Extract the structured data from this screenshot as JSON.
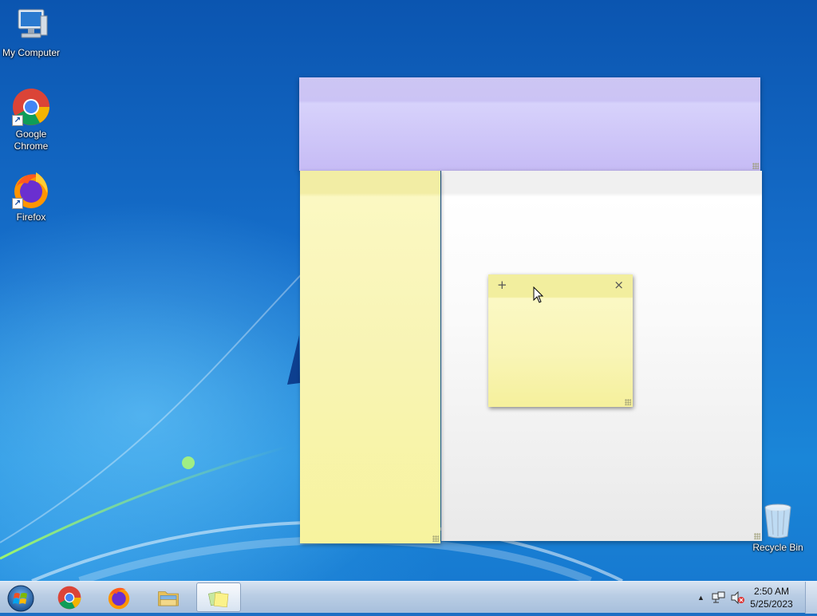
{
  "desktop": {
    "icons": [
      {
        "label": "My Computer",
        "icon": "computer-icon"
      },
      {
        "label": "Google Chrome",
        "label_line1": "Google",
        "label_line2": "Chrome",
        "icon": "chrome-icon"
      },
      {
        "label": "Firefox",
        "icon": "firefox-icon"
      },
      {
        "label": "Recycle Bin",
        "icon": "recycle-bin-icon"
      }
    ]
  },
  "sticky_notes": {
    "windows": [
      {
        "color": "#c9bff5",
        "name": "purple-note"
      },
      {
        "color": "#f2f2f2",
        "name": "white-note"
      },
      {
        "color": "#f8f4b4",
        "name": "yellow-note-tall"
      },
      {
        "color": "#f9f5b6",
        "name": "yellow-note-small"
      }
    ],
    "new_note_glyph": "+",
    "close_glyph": "×"
  },
  "taskbar": {
    "buttons": [
      {
        "name": "start-button",
        "icon": "windows-logo-icon"
      },
      {
        "name": "taskbar-chrome",
        "icon": "chrome-icon"
      },
      {
        "name": "taskbar-firefox",
        "icon": "firefox-icon"
      },
      {
        "name": "taskbar-explorer",
        "icon": "folder-icon"
      },
      {
        "name": "taskbar-sticky-notes",
        "icon": "sticky-notes-icon",
        "active": true
      }
    ],
    "tray": {
      "show_hidden_glyph": "▲",
      "network_icon": "network-icon",
      "volume_icon": "volume-muted-icon"
    },
    "clock": {
      "time": "2:50 AM",
      "date": "5/25/2023"
    }
  },
  "colors": {
    "taskbar": "#b9cde4",
    "desktop_blue": "#1670cc",
    "note_yellow": "#f8f4b4",
    "note_purple": "#c9bff5"
  }
}
